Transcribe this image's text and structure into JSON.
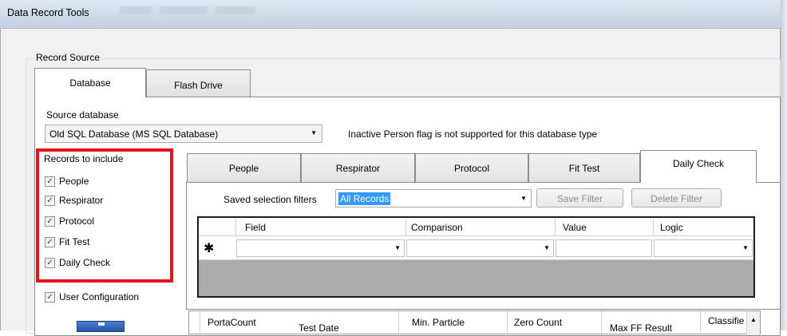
{
  "window": {
    "title": "Data Record Tools"
  },
  "record_source": {
    "label": "Record Source",
    "tabs": [
      {
        "label": "Database",
        "active": true
      },
      {
        "label": "Flash Drive",
        "active": false
      }
    ]
  },
  "source": {
    "label": "Source database",
    "selected": "Old SQL Database (MS SQL Database)",
    "note": "Inactive Person flag is not supported for this database type"
  },
  "records_to_include": {
    "title": "Records to include",
    "items": [
      {
        "label": "People",
        "checked": true
      },
      {
        "label": "Respirator",
        "checked": true
      },
      {
        "label": "Protocol",
        "checked": true
      },
      {
        "label": "Fit Test",
        "checked": true
      },
      {
        "label": "Daily Check",
        "checked": true
      }
    ],
    "highlight_color": "#e3141c"
  },
  "user_configuration": {
    "label": "User Configuration",
    "checked": true
  },
  "inner_tabs": [
    {
      "label": "People",
      "active": false
    },
    {
      "label": "Respirator",
      "active": false
    },
    {
      "label": "Protocol",
      "active": false
    },
    {
      "label": "Fit Test",
      "active": false
    },
    {
      "label": "Daily Check",
      "active": true
    }
  ],
  "filters": {
    "label": "Saved selection filters",
    "selected": "All Records",
    "save_label": "Save Filter",
    "delete_label": "Delete Filter"
  },
  "filter_grid": {
    "columns": [
      "Field",
      "Comparison",
      "Value",
      "Logic"
    ],
    "new_row_marker": "✱"
  },
  "results_grid": {
    "columns": [
      "PortaCount",
      "Test Date",
      "Min. Particle",
      "Zero Count",
      "Max FF Result",
      "Classifie"
    ]
  },
  "icons": {
    "check": "✓",
    "dropdown": "▼",
    "scroll_up": "▲"
  }
}
